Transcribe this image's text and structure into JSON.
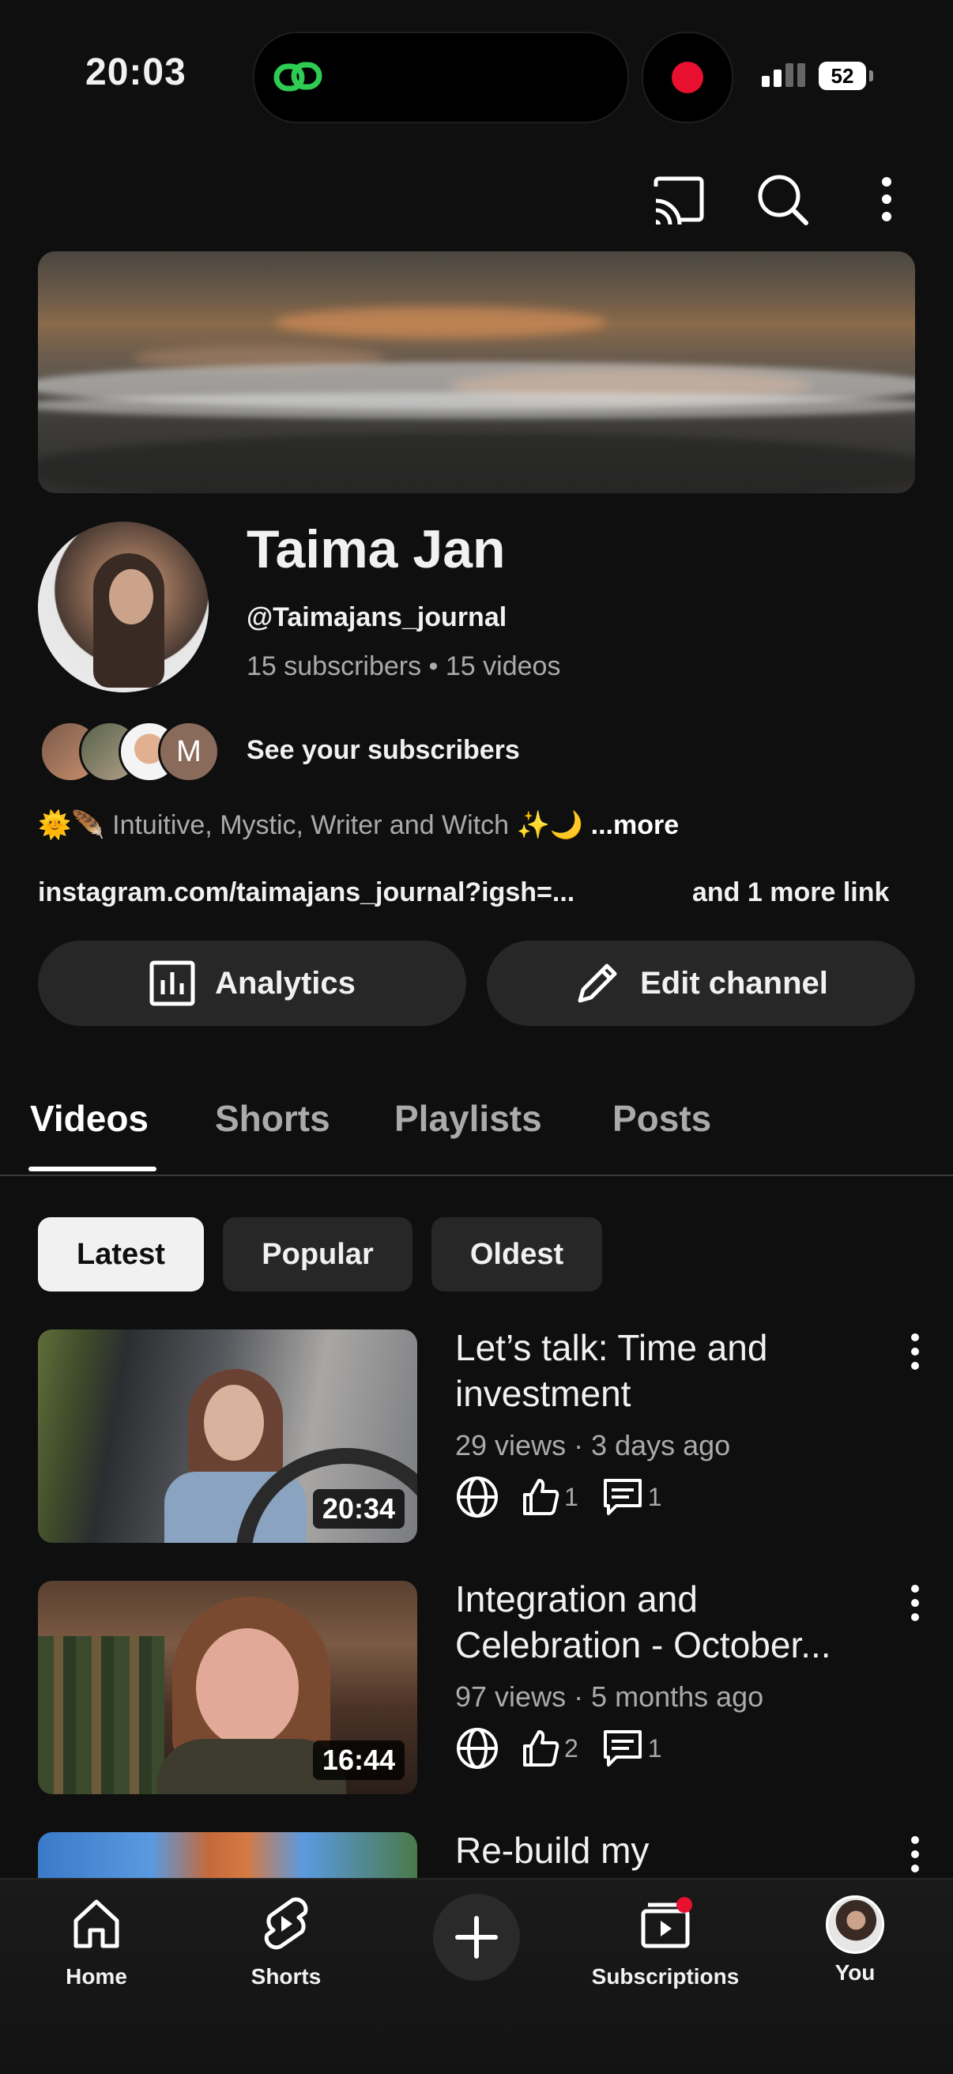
{
  "status_bar": {
    "time": "20:03",
    "battery": "52"
  },
  "top_bar": {
    "icons": [
      "cast-icon",
      "search-icon",
      "more-vert-icon"
    ]
  },
  "channel": {
    "name": "Taima Jan",
    "handle": "@Taimajans_journal",
    "stats": "15 subscribers  •  15 videos",
    "see_subscribers": "See your subscribers",
    "subscriber_initial": "M",
    "bio_emoji": "🌞🪶",
    "bio": "Intuitive, Mystic, Writer and Witch ✨🌙",
    "bio_more": "...more",
    "link": "instagram.com/taimajans_journal?igsh=...",
    "more_links": "and 1 more link"
  },
  "buttons": {
    "analytics": "Analytics",
    "edit": "Edit channel"
  },
  "tabs": [
    {
      "label": "Videos",
      "active": true
    },
    {
      "label": "Shorts",
      "active": false
    },
    {
      "label": "Playlists",
      "active": false
    },
    {
      "label": "Posts",
      "active": false
    }
  ],
  "chips": [
    {
      "label": "Latest",
      "active": true
    },
    {
      "label": "Popular",
      "active": false
    },
    {
      "label": "Oldest",
      "active": false
    }
  ],
  "videos": [
    {
      "title": "Let’s talk: Time and investment",
      "meta": "29 views · 3 days ago",
      "duration": "20:34",
      "likes": "1",
      "comments": "1"
    },
    {
      "title": "Integration and Celebration - October...",
      "meta": "97 views · 5 months ago",
      "duration": "16:44",
      "likes": "2",
      "comments": "1"
    },
    {
      "title": "Re-build my"
    }
  ],
  "nav": {
    "home": "Home",
    "shorts": "Shorts",
    "subscriptions": "Subscriptions",
    "you": "You"
  },
  "colors": {
    "background": "#0f0f0f",
    "chip_active": "#f1f1f1",
    "notification": "#e8102e",
    "link_green": "#2ecc52"
  }
}
